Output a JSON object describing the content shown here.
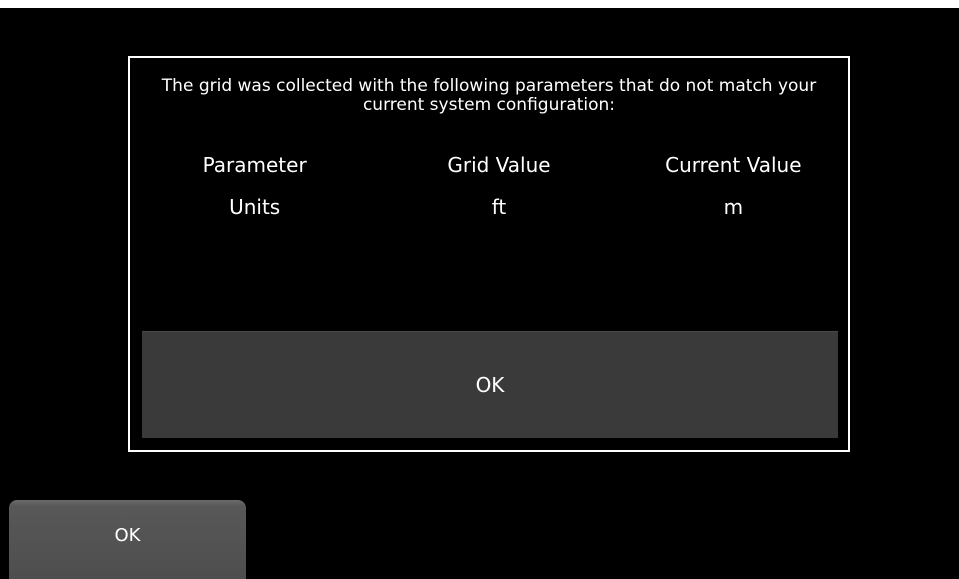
{
  "dialog": {
    "message": "The grid was collected with the following parameters that do not match your current system configuration:",
    "table": {
      "headers": [
        "Parameter",
        "Grid Value",
        "Current Value"
      ],
      "rows": [
        [
          "Units",
          "ft",
          "m"
        ]
      ]
    },
    "ok_label": "OK"
  },
  "background": {
    "ok_label": "OK"
  }
}
